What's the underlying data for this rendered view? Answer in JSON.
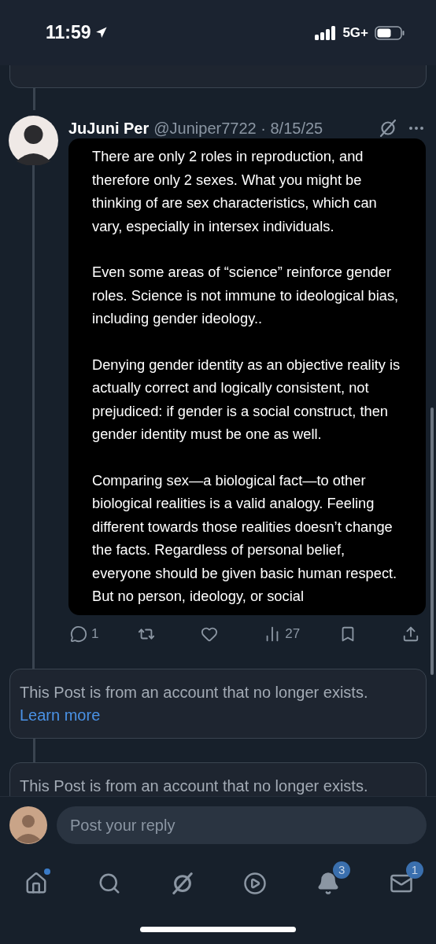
{
  "status_bar": {
    "time": "11:59",
    "network": "5G+"
  },
  "post": {
    "author": "JuJuni Per",
    "handle": "@Juniper7722",
    "separator": "·",
    "date": "8/15/25",
    "paragraphs": [
      "There are only 2 roles in reproduction, and therefore only 2 sexes. What you might be thinking of are sex characteristics, which can vary, especially in intersex individuals.",
      "Even some areas of “science” reinforce gender roles. Science is not immune to ideological bias, including gender ideology..",
      "Denying gender identity as an objective reality is actually correct and logically consistent, not prejudiced: if gender is a social construct, then gender identity must be one as well.",
      "Comparing sex—a biological fact—to other biological realities is a valid analogy. Feeling different towards those realities doesn’t change the facts. Regardless of personal belief, everyone should be given basic human respect. But no person, ideology, or social"
    ],
    "actions": [
      {
        "kind": "reply",
        "count": "1"
      },
      {
        "kind": "repost"
      },
      {
        "kind": "like"
      },
      {
        "kind": "views",
        "count": "27"
      },
      {
        "kind": "bookmark"
      },
      {
        "kind": "share"
      }
    ]
  },
  "deleted_posts": [
    {
      "text": "This Post is from an account that no longer exists.",
      "link": "Learn more"
    },
    {
      "text": "This Post is from an account that no longer exists."
    }
  ],
  "reply_field": {
    "placeholder": "Post your reply"
  },
  "nav": [
    {
      "kind": "home",
      "dot": true
    },
    {
      "kind": "search",
      "dot": false
    },
    {
      "kind": "grok",
      "dot": false
    },
    {
      "kind": "video",
      "dot": false
    },
    {
      "kind": "notifications",
      "dot": false,
      "badge": "3"
    },
    {
      "kind": "messages",
      "dot": false,
      "badge": "1"
    }
  ]
}
